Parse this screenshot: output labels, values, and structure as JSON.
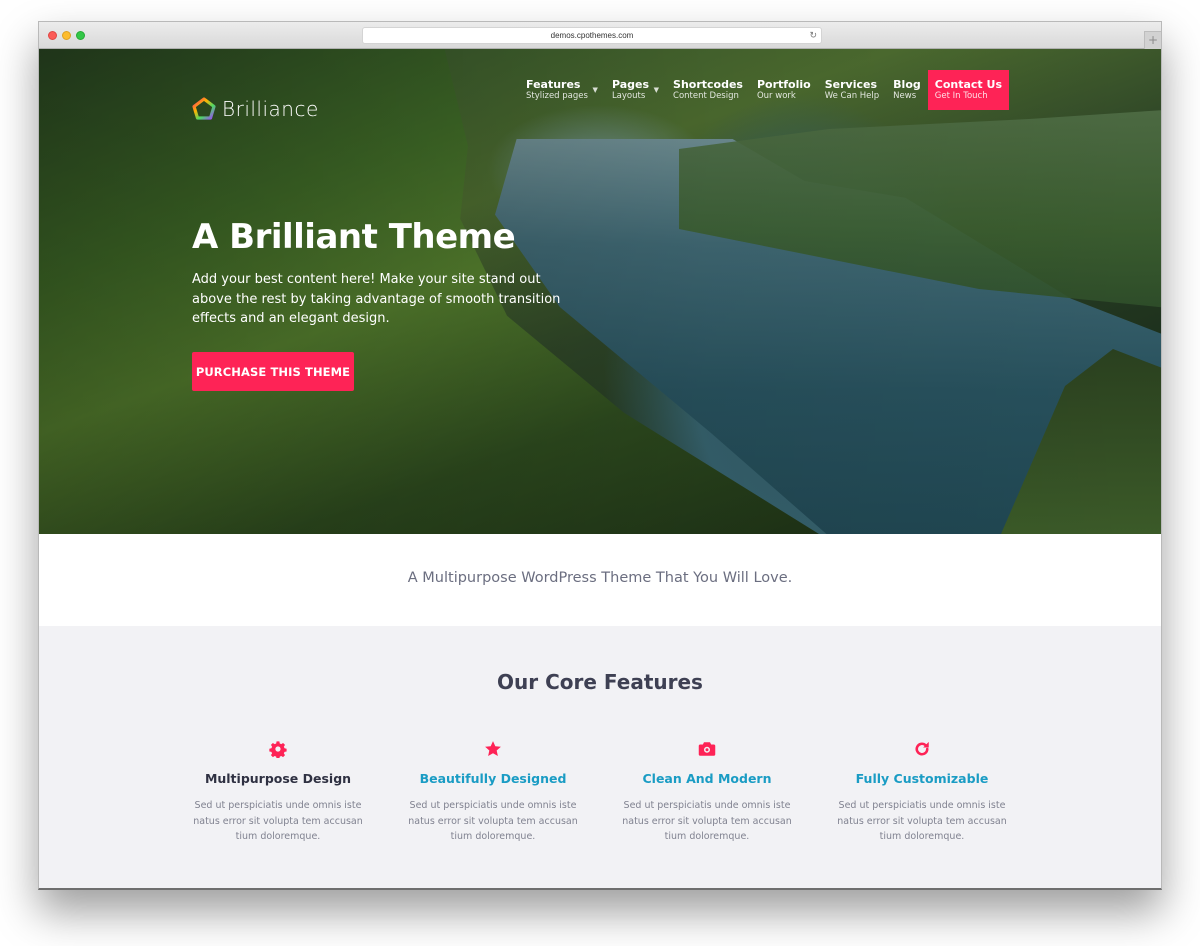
{
  "browser": {
    "url": "demos.cpothemes.com",
    "new_tab_label": "+"
  },
  "site": {
    "logo_text": "Brilliance",
    "nav": [
      {
        "title": "Features",
        "subtitle": "Stylized pages",
        "has_dropdown": true
      },
      {
        "title": "Pages",
        "subtitle": "Layouts",
        "has_dropdown": true
      },
      {
        "title": "Shortcodes",
        "subtitle": "Content Design",
        "has_dropdown": false
      },
      {
        "title": "Portfolio",
        "subtitle": "Our work",
        "has_dropdown": false
      },
      {
        "title": "Services",
        "subtitle": "We Can Help",
        "has_dropdown": false
      },
      {
        "title": "Blog",
        "subtitle": "News",
        "has_dropdown": false
      },
      {
        "title": "Contact Us",
        "subtitle": "Get In Touch",
        "has_dropdown": false,
        "highlighted": true
      }
    ]
  },
  "hero": {
    "title": "A Brilliant Theme",
    "text": "Add your best content here! Make your site stand out above the rest by taking advantage of smooth transition effects and an elegant design.",
    "cta_label": "PURCHASE THIS THEME"
  },
  "tagline": "A Multipurpose WordPress Theme That You Will Love.",
  "features": {
    "title": "Our Core Features",
    "items": [
      {
        "icon": "gear-icon",
        "title": "Multipurpose Design",
        "title_color": "#2f3142",
        "description": "Sed ut perspiciatis unde omnis iste natus error sit volupta tem accusan tium doloremque."
      },
      {
        "icon": "star-icon",
        "title": "Beautifully Designed",
        "title_color": "#1a9cc4",
        "description": "Sed ut perspiciatis unde omnis iste natus error sit volupta tem accusan tium doloremque."
      },
      {
        "icon": "camera-icon",
        "title": "Clean And Modern",
        "title_color": "#1a9cc4",
        "description": "Sed ut perspiciatis unde omnis iste natus error sit volupta tem accusan tium doloremque."
      },
      {
        "icon": "refresh-icon",
        "title": "Fully Customizable",
        "title_color": "#1a9cc4",
        "description": "Sed ut perspiciatis unde omnis iste natus error sit volupta tem accusan tium doloremque."
      }
    ]
  },
  "colors": {
    "accent": "#fe2356",
    "link_blue": "#1a9cc4",
    "heading": "#3e4053",
    "muted": "#808290"
  }
}
